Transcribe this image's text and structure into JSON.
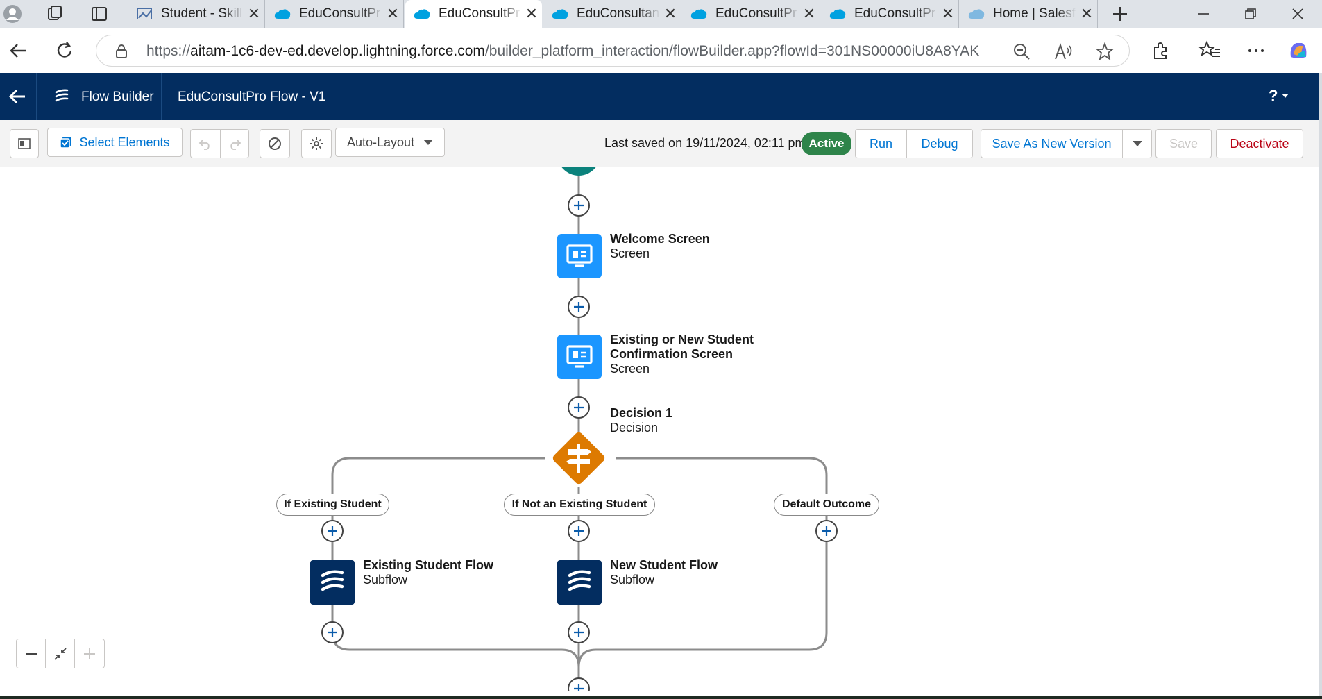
{
  "browser": {
    "tabs": [
      {
        "title": "Student - Skill",
        "favicon": "image-icon",
        "active": false
      },
      {
        "title": "EduConsultPr",
        "favicon": "salesforce-cloud-icon",
        "active": false
      },
      {
        "title": "EduConsultPr",
        "favicon": "salesforce-cloud-icon",
        "active": true
      },
      {
        "title": "EduConsultan",
        "favicon": "salesforce-cloud-icon",
        "active": false
      },
      {
        "title": "EduConsultPr",
        "favicon": "salesforce-cloud-icon",
        "active": false
      },
      {
        "title": "EduConsultPr",
        "favicon": "salesforce-cloud-icon",
        "active": false
      },
      {
        "title": "Home | Salesf",
        "favicon": "salesforce-cloud-icon",
        "active": false
      }
    ],
    "url_origin": "https://",
    "url_host": "aitam-1c6-dev-ed.develop.lightning.force.com",
    "url_path": "/builder_platform_interaction/flowBuilder.app?flowId=301NS00000iU8A8YAK"
  },
  "header": {
    "app_name": "Flow Builder",
    "flow_title": "EduConsultPro Flow - V1",
    "help_label": "?"
  },
  "toolbar": {
    "select_elements": "Select Elements",
    "layout_mode": "Auto-Layout",
    "last_saved": "Last saved on 19/11/2024, 02:11 pm",
    "status": "Active",
    "run": "Run",
    "debug": "Debug",
    "save_as_new": "Save As New Version",
    "save": "Save",
    "deactivate": "Deactivate"
  },
  "flow": {
    "welcome": {
      "name": "Welcome Screen",
      "type": "Screen"
    },
    "confirm": {
      "name_line1": "Existing or New Student",
      "name_line2": "Confirmation Screen",
      "type": "Screen"
    },
    "decision": {
      "name": "Decision 1",
      "type": "Decision"
    },
    "outcomes": {
      "existing": "If Existing Student",
      "not_existing": "If Not an Existing Student",
      "default": "Default Outcome"
    },
    "existing_flow": {
      "name": "Existing Student Flow",
      "type": "Subflow"
    },
    "new_flow": {
      "name": "New Student Flow",
      "type": "Subflow"
    }
  },
  "colors": {
    "header_bg": "#032d60",
    "screen_node": "#1b96ff",
    "decision_node": "#dd7a01",
    "start_node": "#0b827c",
    "active_badge": "#2e844a",
    "deactivate_text": "#ba0517"
  }
}
